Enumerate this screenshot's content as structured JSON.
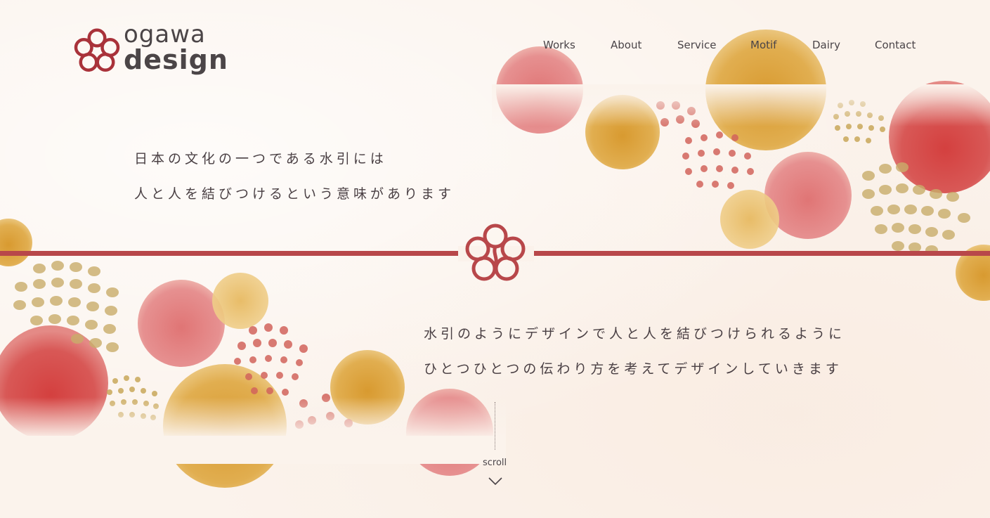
{
  "brand": {
    "line1": "ogawa",
    "line2": "design",
    "accent_color": "#b8474a",
    "logo_icon": "mizuhiki-knot-icon"
  },
  "nav": {
    "items": [
      {
        "label": "Works"
      },
      {
        "label": "About"
      },
      {
        "label": "Service"
      },
      {
        "label": "Motif"
      },
      {
        "label": "Dairy"
      },
      {
        "label": "Contact"
      }
    ]
  },
  "hero": {
    "lines_top": [
      "日本の文化の一つである水引には",
      "人と人を結びつけるという意味があります"
    ],
    "lines_bottom": [
      "水引のようにデザインで人と人を結びつけられるように",
      "ひとつひとつの伝わり方を考えてデザインしていきます"
    ],
    "colors": {
      "red": "#d5484a",
      "mustard": "#d9a23a",
      "pink": "#e07a78",
      "background": "#fbf3ec"
    }
  },
  "scroll": {
    "label": "scroll",
    "icon": "chevron-down-icon"
  }
}
